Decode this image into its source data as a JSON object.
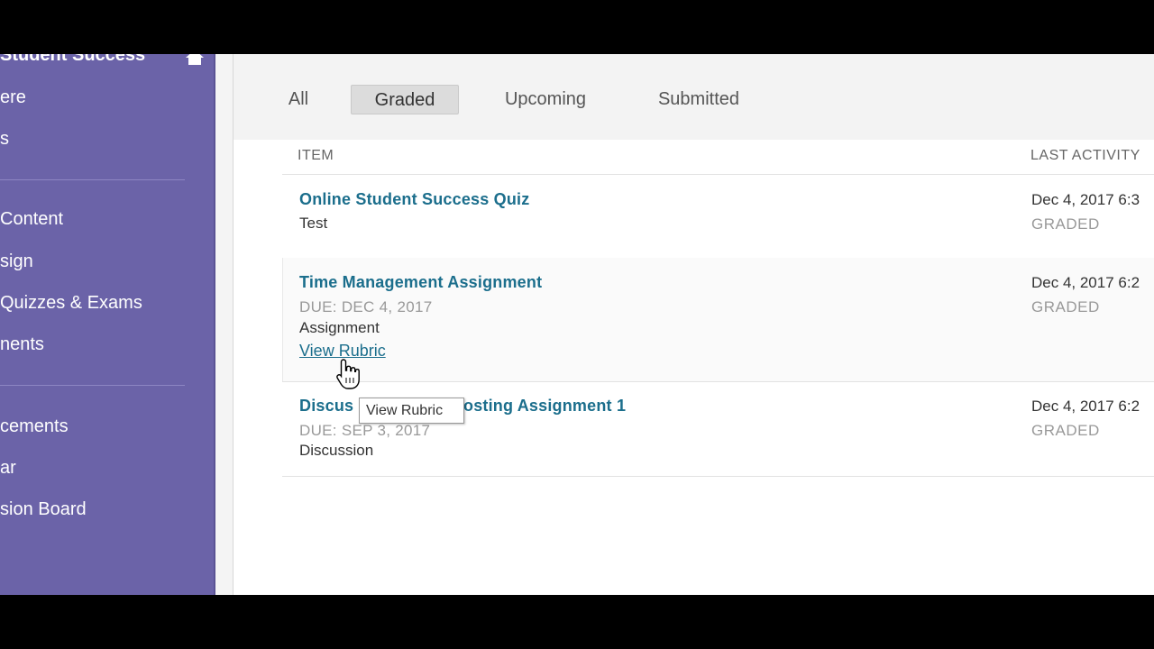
{
  "sidebar": {
    "course_title": "Student Success",
    "items": [
      {
        "label": "ere"
      },
      {
        "label": "s"
      },
      {
        "label": "Content"
      },
      {
        "label": "sign"
      },
      {
        "label": "Quizzes & Exams"
      },
      {
        "label": "nents"
      },
      {
        "label": "cements"
      },
      {
        "label": "ar"
      },
      {
        "label": "sion Board"
      }
    ],
    "bg_color": "#6b63a8"
  },
  "tabs": [
    {
      "label": "All",
      "active": false
    },
    {
      "label": "Graded",
      "active": true
    },
    {
      "label": "Upcoming",
      "active": false
    },
    {
      "label": "Submitted",
      "active": false
    }
  ],
  "columns": {
    "item": "ITEM",
    "last_activity": "LAST ACTIVITY"
  },
  "rows": [
    {
      "title": "Online Student Success Quiz",
      "type": "Test",
      "activity_date": "Dec 4, 2017 6:3",
      "status": "GRADED"
    },
    {
      "title": "Time Management Assignment",
      "due": "DUE: DEC 4, 2017",
      "type": "Assignment",
      "link": "View Rubric",
      "activity_date": "Dec 4, 2017 6:2",
      "status": "GRADED"
    },
    {
      "title_left": "Discus",
      "title_right": "osting Assignment 1",
      "due": "DUE: SEP 3, 2017",
      "type": "Discussion",
      "activity_date": "Dec 4, 2017 6:2",
      "status": "GRADED"
    }
  ],
  "tooltip": "View Rubric",
  "colors": {
    "link": "#1b6e8c",
    "muted": "#999999"
  }
}
